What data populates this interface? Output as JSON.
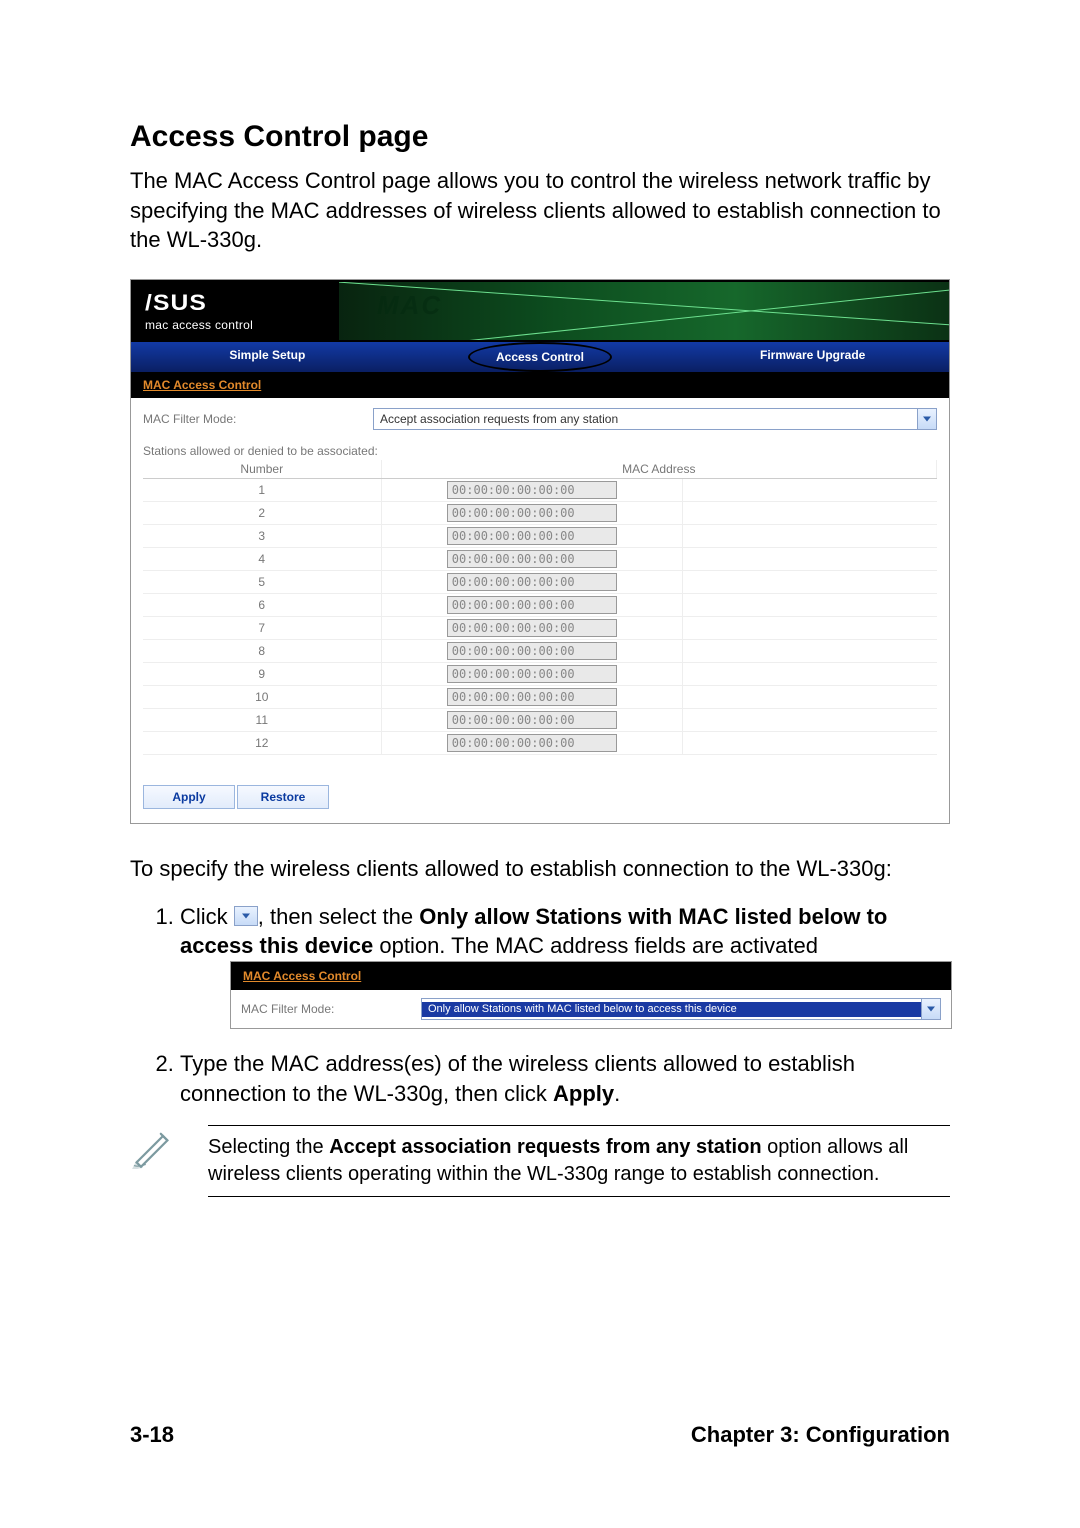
{
  "title": "Access Control page",
  "intro": "The MAC Access Control page allows you to control the wireless network traffic by specifying the MAC addresses of wireless clients allowed to establish connection to the WL-330g.",
  "screenshot1": {
    "logo_sub": "mac access control",
    "tabs": [
      "Simple Setup",
      "Access Control",
      "Firmware Upgrade"
    ],
    "section_header": "MAC Access Control",
    "mode_label": "MAC Filter Mode:",
    "mode_value": "Accept association requests from any station",
    "stations_label": "Stations allowed or denied to be associated:",
    "col_number": "Number",
    "col_mac": "MAC Address",
    "rows": [
      {
        "n": "1",
        "mac": "00:00:00:00:00:00"
      },
      {
        "n": "2",
        "mac": "00:00:00:00:00:00"
      },
      {
        "n": "3",
        "mac": "00:00:00:00:00:00"
      },
      {
        "n": "4",
        "mac": "00:00:00:00:00:00"
      },
      {
        "n": "5",
        "mac": "00:00:00:00:00:00"
      },
      {
        "n": "6",
        "mac": "00:00:00:00:00:00"
      },
      {
        "n": "7",
        "mac": "00:00:00:00:00:00"
      },
      {
        "n": "8",
        "mac": "00:00:00:00:00:00"
      },
      {
        "n": "9",
        "mac": "00:00:00:00:00:00"
      },
      {
        "n": "10",
        "mac": "00:00:00:00:00:00"
      },
      {
        "n": "11",
        "mac": "00:00:00:00:00:00"
      },
      {
        "n": "12",
        "mac": "00:00:00:00:00:00"
      }
    ],
    "apply": "Apply",
    "restore": "Restore"
  },
  "para_after": "To specify the wireless clients allowed to establish connection to the WL-330g:",
  "steps": {
    "s1_a": "Click ",
    "s1_b": ", then select the ",
    "s1_bold": "Only allow Stations with MAC listed below to access this device",
    "s1_c": " option. The MAC address fields are activated",
    "s2_a": "Type the MAC address(es) of the wireless clients allowed to establish connection to the WL-330g, then click ",
    "s2_bold": "Apply",
    "s2_b": "."
  },
  "screenshot2": {
    "section_header": "MAC Access Control",
    "mode_label": "MAC Filter Mode:",
    "mode_value": "Only allow Stations with MAC listed below to access this device"
  },
  "note": {
    "a": "Selecting the ",
    "bold": "Accept association requests from any station",
    "b": " option allows all wireless clients operating within the WL-330g range to establish connection."
  },
  "footer": {
    "page": "3-18",
    "chapter": "Chapter 3: Configuration"
  }
}
